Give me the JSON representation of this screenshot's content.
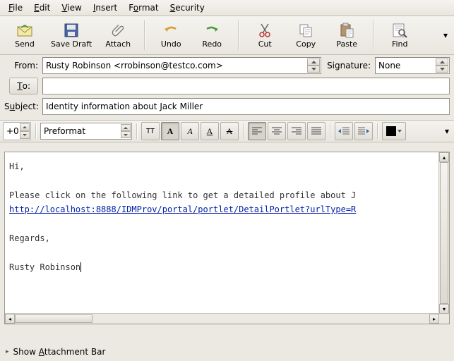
{
  "menu": {
    "file": "File",
    "edit": "Edit",
    "view": "View",
    "insert": "Insert",
    "format": "Format",
    "security": "Security"
  },
  "toolbar": {
    "send": "Send",
    "save": "Save Draft",
    "attach": "Attach",
    "undo": "Undo",
    "redo": "Redo",
    "cut": "Cut",
    "copy": "Copy",
    "paste": "Paste",
    "find": "Find"
  },
  "header": {
    "from_label": "From:",
    "from_value": "Rusty Robinson <rrobinson@testco.com>",
    "sig_label": "Signature:",
    "sig_value": "None",
    "to_label": "To:",
    "to_value": "",
    "subject_label": "Subject:",
    "subject_value": "Identity information about Jack Miller"
  },
  "format": {
    "indent_label": "+0",
    "style": "Preformat"
  },
  "body": {
    "line1": "Hi,",
    "line2": "Please click on the following link to get a detailed profile about J",
    "link": "http://localhost:8888/IDMProv/portal/portlet/DetailPortlet?urlType=R",
    "line3": "Regards,",
    "line4": "Rusty Robinson"
  },
  "footer": {
    "attach": "Show Attachment Bar"
  }
}
